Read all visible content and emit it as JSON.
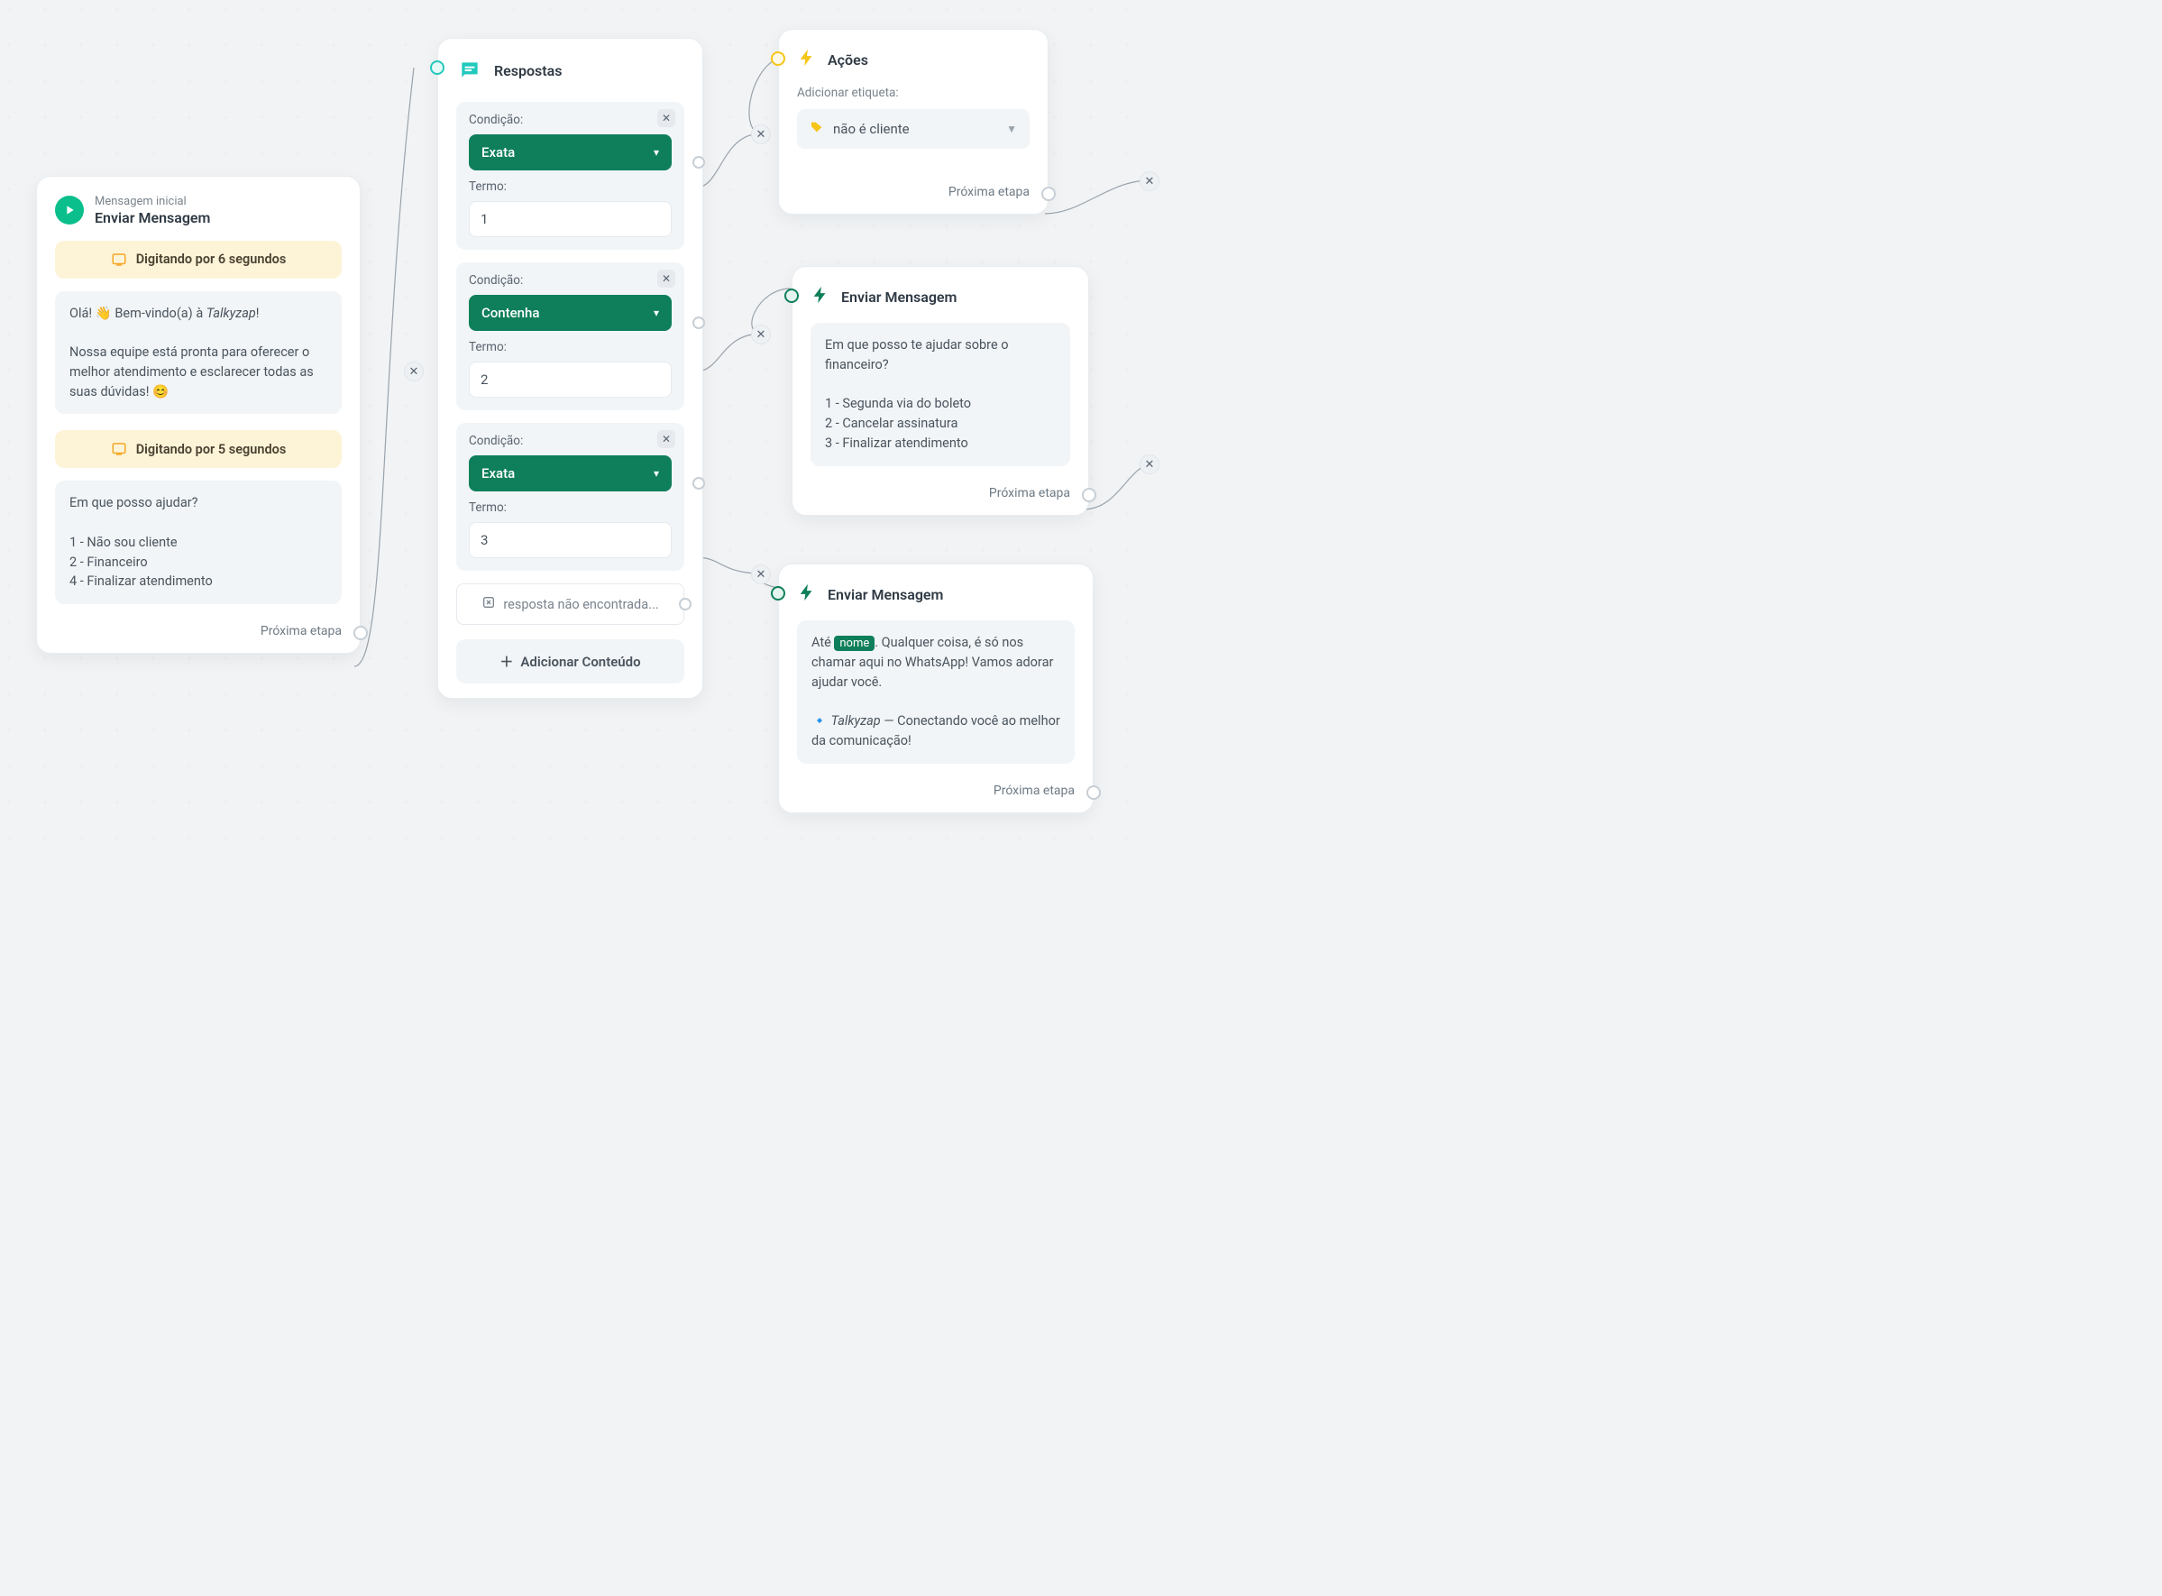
{
  "common": {
    "next_step": "Próxima etapa",
    "condition_label": "Condição:",
    "term_label": "Termo:"
  },
  "start_node": {
    "subtitle": "Mensagem inicial",
    "title": "Enviar Mensagem",
    "typing1": "Digitando por 6 segundos",
    "bubble1_line1": "Olá! 👋 Bem-vindo(a) à ",
    "bubble1_brand": "Talkyzap",
    "bubble1_line1b": "!",
    "bubble1_line2": "Nossa equipe está pronta para oferecer o melhor atendimento e esclarecer todas as suas dúvidas! 😊",
    "typing2": "Digitando por 5 segundos",
    "bubble2_line1": "Em que posso ajudar?",
    "bubble2_opt1": "1 - Não sou cliente",
    "bubble2_opt2": "2 - Financeiro",
    "bubble2_opt3": "4 - Finalizar atendimento"
  },
  "responses_node": {
    "title": "Respostas",
    "items": [
      {
        "condition": "Exata",
        "term": "1"
      },
      {
        "condition": "Contenha",
        "term": "2"
      },
      {
        "condition": "Exata",
        "term": "3"
      }
    ],
    "not_found": "resposta não encontrada...",
    "add_content": "Adicionar Conteúdo"
  },
  "actions_node": {
    "title": "Ações",
    "field": "Adicionar etiqueta:",
    "tag": "não é cliente"
  },
  "send2_node": {
    "title": "Enviar Mensagem",
    "line1": "Em que posso te ajudar sobre o financeiro?",
    "opt1": "1 - Segunda via do boleto",
    "opt2": "2 - Cancelar assinatura",
    "opt3": "3 - Finalizar atendimento"
  },
  "send3_node": {
    "title": "Enviar Mensagem",
    "pre": "Até ",
    "var": "nome",
    "post": ". Qualquer coisa, é só nos chamar aqui no WhatsApp! Vamos adorar ajudar você.",
    "line2a": "🔹 ",
    "brand": "Talkyzap",
    "line2b": " — Conectando você ao melhor da comunicação!"
  }
}
